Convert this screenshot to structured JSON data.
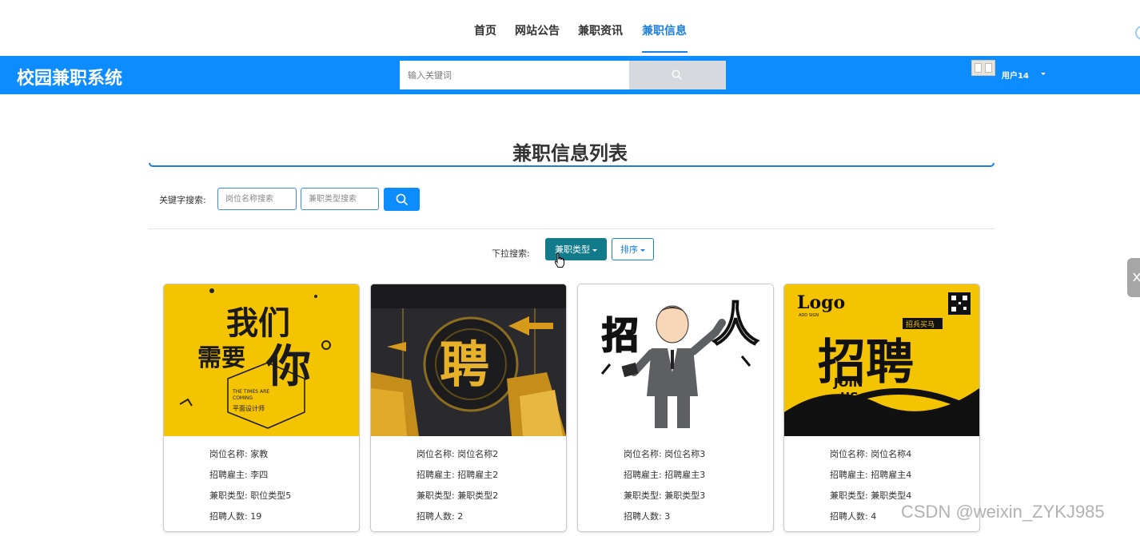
{
  "top_nav": {
    "items": [
      {
        "label": "首页",
        "active": false
      },
      {
        "label": "网站公告",
        "active": false
      },
      {
        "label": "兼职资讯",
        "active": false
      },
      {
        "label": "兼职信息",
        "active": true
      }
    ]
  },
  "header": {
    "brand": "校园兼职系统",
    "search_placeholder": "输入关键词",
    "search_icon": "search-icon",
    "user_name": "用户14"
  },
  "section": {
    "title": "兼职信息列表"
  },
  "keyword_search": {
    "label": "关键字搜索:",
    "position_placeholder": "岗位名称搜索",
    "type_placeholder": "兼职类型搜索",
    "button_icon": "search-icon"
  },
  "dropdown_search": {
    "label": "下拉搜索:",
    "type_button": "兼职类型",
    "sort_button": "排序"
  },
  "cards": [
    {
      "image_alt": "我们需要你 平面设计师",
      "image_texts": [
        "我们",
        "需要",
        "你",
        "THE TIMES ARE",
        "COMING",
        "平面设计师"
      ],
      "position_label": "岗位名称:",
      "position": "家教",
      "employer_label": "招聘雇主:",
      "employer": "李四",
      "type_label": "兼职类型:",
      "type": "职位类型5",
      "count_label": "招聘人数:",
      "count": "19"
    },
    {
      "image_alt": "聘",
      "image_texts": [
        "聘"
      ],
      "position_label": "岗位名称:",
      "position": "岗位名称2",
      "employer_label": "招聘雇主:",
      "employer": "招聘雇主2",
      "type_label": "兼职类型:",
      "type": "兼职类型2",
      "count_label": "招聘人数:",
      "count": "2"
    },
    {
      "image_alt": "招人",
      "image_texts": [
        "招",
        "人"
      ],
      "position_label": "岗位名称:",
      "position": "岗位名称3",
      "employer_label": "招聘雇主:",
      "employer": "招聘雇主3",
      "type_label": "兼职类型:",
      "type": "兼职类型3",
      "count_label": "招聘人数:",
      "count": "3"
    },
    {
      "image_alt": "招聘 JOIN US",
      "image_texts": [
        "Logo",
        "ADD SIGN",
        "招兵买马",
        "招聘",
        "JOIN",
        "US"
      ],
      "position_label": "岗位名称:",
      "position": "岗位名称4",
      "employer_label": "招聘雇主:",
      "employer": "招聘雇主4",
      "type_label": "兼职类型:",
      "type": "兼职类型4",
      "count_label": "招聘人数:",
      "count": "4"
    }
  ],
  "watermark": "CSDN @weixin_ZYKJ985",
  "colors": {
    "primary": "#0d8cff",
    "nav_active": "#1a7fe0",
    "type_button": "#117a8b",
    "poster_yellow": "#f5c400"
  }
}
